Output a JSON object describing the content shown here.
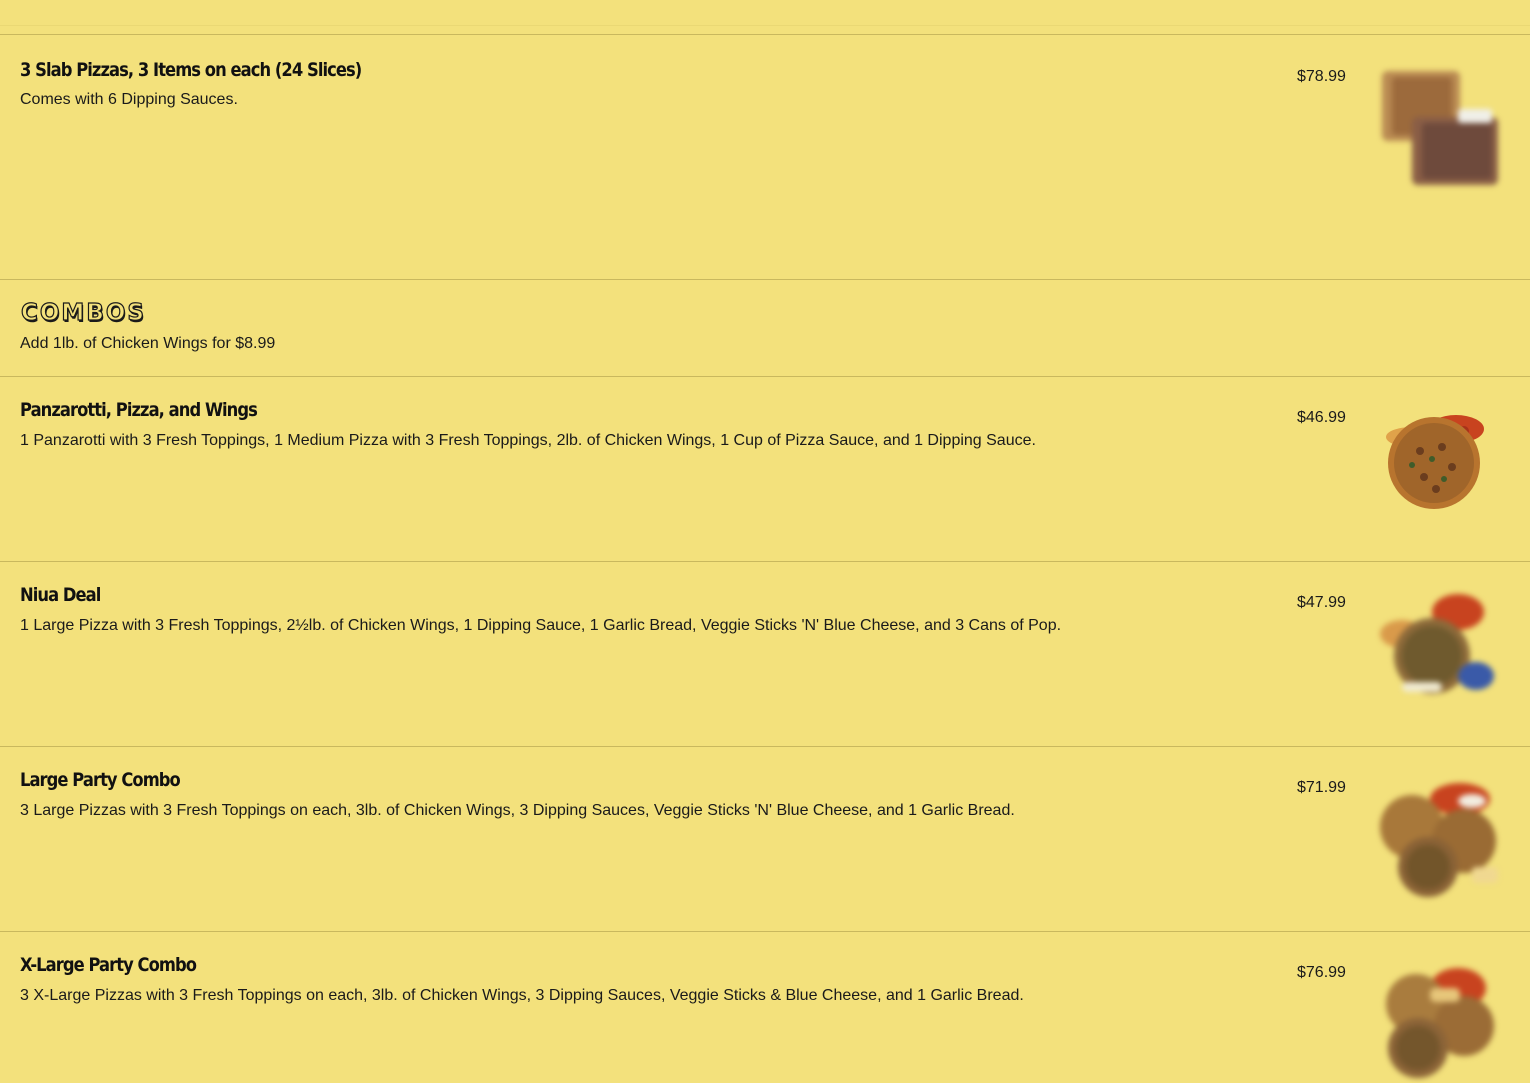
{
  "colors": {
    "background": "#f3e17c",
    "divider": "#c9b85e",
    "text": "#111111"
  },
  "items_top": [
    {
      "title": "3 Slab Pizzas, 3 Items on each (24 Slices)",
      "description": "Comes with 6 Dipping Sauces.",
      "price": "$78.99",
      "image": "slab-pizzas-photo"
    }
  ],
  "section": {
    "title": "COMBOS",
    "subtitle": "Add 1lb. of Chicken Wings for $8.99"
  },
  "items": [
    {
      "title": "Panzarotti, Pizza, and Wings",
      "description": "1 Panzarotti with 3 Fresh Toppings, 1 Medium Pizza with 3 Fresh Toppings, 2lb. of Chicken Wings, 1 Cup of Pizza Sauce, and 1 Dipping Sauce.",
      "price": "$46.99",
      "image": "pizza-wings-photo"
    },
    {
      "title": "Niua Deal",
      "description": "1 Large Pizza with 3 Fresh Toppings, 2½lb. of Chicken Wings, 1 Dipping Sauce, 1 Garlic Bread, Veggie Sticks 'N' Blue Cheese, and 3 Cans of Pop.",
      "price": "$47.99",
      "image": "niua-deal-photo"
    },
    {
      "title": "Large Party Combo",
      "description": "3 Large Pizzas with 3 Fresh Toppings on each, 3lb. of Chicken Wings, 3 Dipping Sauces, Veggie Sticks 'N' Blue Cheese, and 1 Garlic Bread.",
      "price": "$71.99",
      "image": "large-party-combo-photo"
    },
    {
      "title": "X-Large Party Combo",
      "description": "3 X-Large Pizzas with 3 Fresh Toppings on each, 3lb. of Chicken Wings, 3 Dipping Sauces, Veggie Sticks & Blue Cheese, and 1 Garlic Bread.",
      "price": "$76.99",
      "image": "xlarge-party-combo-photo"
    }
  ]
}
